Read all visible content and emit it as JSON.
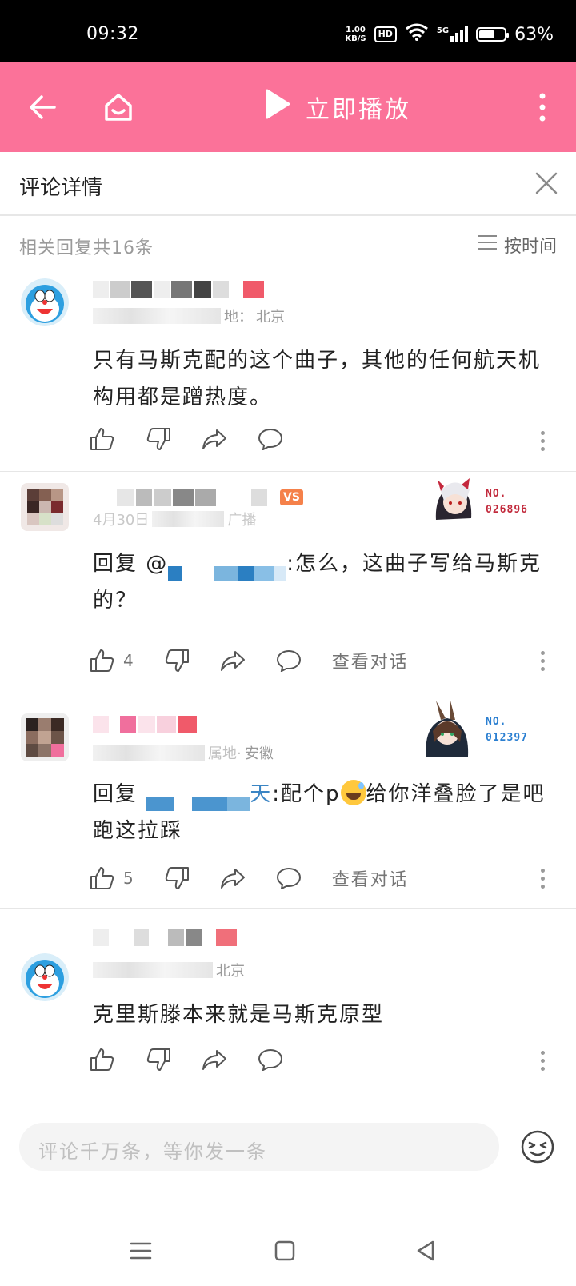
{
  "status_bar": {
    "time": "09:32",
    "net_speed_value": "1.00",
    "net_speed_unit": "KB/S",
    "hd": "HD",
    "network": "5G",
    "battery_percent": "63%",
    "battery_level": 0.63
  },
  "app_bar": {
    "back_icon": "back-arrow-icon",
    "home_icon": "home-icon",
    "play_label": "立即播放",
    "more_icon": "more-vertical-icon",
    "color": "#fb7299"
  },
  "detail": {
    "title": "评论详情",
    "close_icon": "close-icon"
  },
  "reply_info": {
    "count_label": "相关回复共16条",
    "sort_label": "按时间"
  },
  "comments": [
    {
      "location": "北京",
      "location_prefix": "地：",
      "text": "只有马斯克配的这个曲子，其他的任何航天机构用都是蹭热度。",
      "like_count": "",
      "view_conversation": ""
    },
    {
      "date_partial": "4月30日",
      "location": "广播",
      "vip_badge": "VS",
      "fan_no": "NO.\n026896",
      "text_prefix": "回复 @",
      "text": ":怎么，这曲子写给马斯克的？",
      "like_count": "4",
      "view_conversation": "查看对话"
    },
    {
      "location": "安徽",
      "location_prefix": "属地·",
      "fan_no": "NO.\n012397",
      "text_prefix": "回复 ",
      "mention_tail": "天",
      "text_a": ":配个p",
      "text_b": "给你洋叠脸了是吧跑这拉踩",
      "like_count": "5",
      "view_conversation": "查看对话"
    },
    {
      "location": "北京",
      "text": "克里斯滕本来就是马斯克原型",
      "like_count": "",
      "view_conversation": ""
    }
  ],
  "input": {
    "placeholder": "评论千万条，等你发一条",
    "emoji_icon": "emoji-face-icon"
  },
  "nav": {
    "menu_icon": "menu-icon",
    "home_icon": "square-home-icon",
    "back_icon": "triangle-back-icon"
  }
}
